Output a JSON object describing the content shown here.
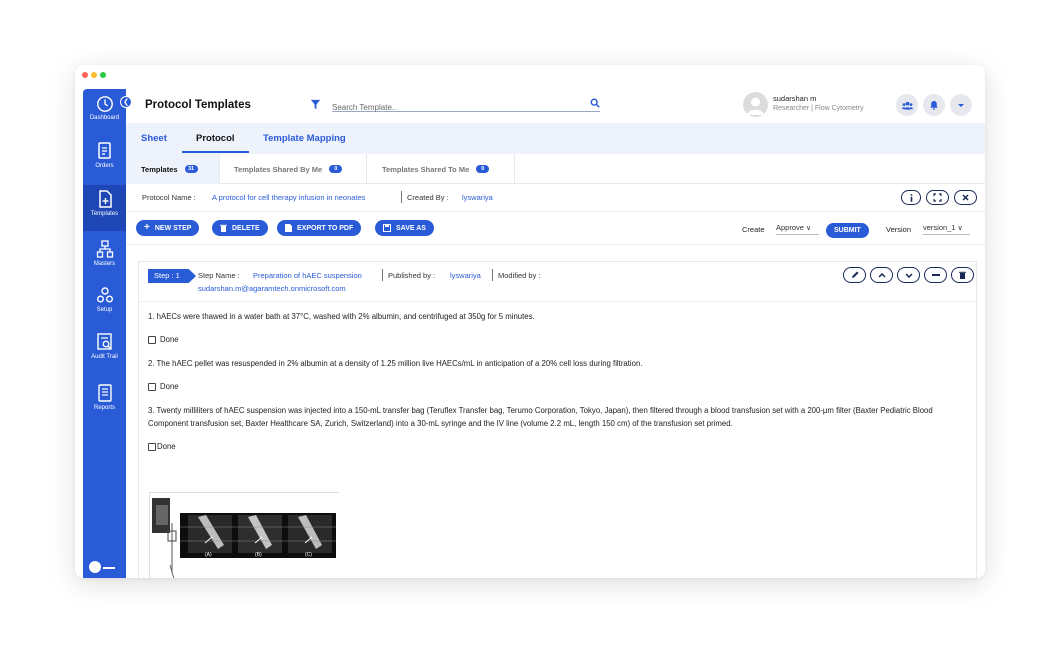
{
  "window": {
    "traffic_colors": [
      "#ff5f57",
      "#febc2e",
      "#28c840"
    ]
  },
  "sidebar": {
    "collapse_icon": "chevron-left-double-icon",
    "items": [
      {
        "label": "Dashboard",
        "icon": "dashboard-gauge-icon"
      },
      {
        "label": "Orders",
        "icon": "orders-document-icon"
      },
      {
        "label": "Templates",
        "icon": "templates-add-document-icon",
        "active": true
      },
      {
        "label": "Masters",
        "icon": "masters-hierarchy-icon"
      },
      {
        "label": "Setup",
        "icon": "setup-gears-icon"
      },
      {
        "label": "Audit Trail",
        "icon": "audit-trail-icon"
      },
      {
        "label": "Reports",
        "icon": "reports-document-icon"
      }
    ]
  },
  "header": {
    "title": "Protocol Templates",
    "search_placeholder": "Search Template..",
    "user_name": "sudarshan m",
    "user_role": "Researcher | Flow Cytometry"
  },
  "tabs": [
    {
      "label": "Sheet"
    },
    {
      "label": "Protocol",
      "active": true
    },
    {
      "label": "Template Mapping"
    }
  ],
  "subtabs": [
    {
      "label": "Templates",
      "count": "31",
      "active": true
    },
    {
      "label": "Templates Shared By Me",
      "count": "0"
    },
    {
      "label": "Templates Shared To Me",
      "count": "0"
    }
  ],
  "protocol": {
    "name_label": "Protocol Name :",
    "name_value": "A protocol for cell therapy infusion in neonates",
    "created_label": "Created By :",
    "created_value": "lyswariya"
  },
  "actions": {
    "new_step": "NEW STEP",
    "delete": "DELETE",
    "export": "EXPORT TO PDF",
    "save_as": "SAVE AS",
    "create_label": "Create",
    "create_value": "Approve",
    "submit": "SUBMIT",
    "version_label": "Version",
    "version_value": "version_1"
  },
  "step": {
    "tag": "Step : 1",
    "name_label": "Step Name :",
    "name_value": "Preparation of hAEC suspension",
    "published_label": "Published by :",
    "published_value": "lyswariya",
    "modified_label": "Modified by :",
    "modified_value": "sudarshan.m@agaramtech.onmicrosoft.com",
    "paragraphs": [
      "1. hAECs were thawed in a water bath at 37°C, washed with 2% albumin, and centrifuged at 350g for 5 minutes.",
      "2. The hAEC pellet was resuspended in 2% albumin at a density of 1.25 million live HAECs/mL in anticipation of a 20% cell loss during filtration.",
      "3. Twenty milliliters of hAEC suspension was injected into a 150-mL transfer bag (Teruflex Transfer bag, Terumo Corporation, Tokyo, Japan), then filtered through a blood transfusion set with a 200-μm filter (Baxter Pediatric Blood Component transfusion set, Baxter Healthcare SA, Zurich, Switzerland) into a 30-mL syringe and the IV line (volume 2.2 mL, length 150 cm) of the transfusion set primed."
    ],
    "done_labels": [
      "Done",
      "Done",
      "Done"
    ],
    "figure_labels": [
      "(A)",
      "(B)",
      "(C)"
    ]
  },
  "colors": {
    "brand": "#2a5bd7",
    "tab_bg": "#eef2fb"
  }
}
